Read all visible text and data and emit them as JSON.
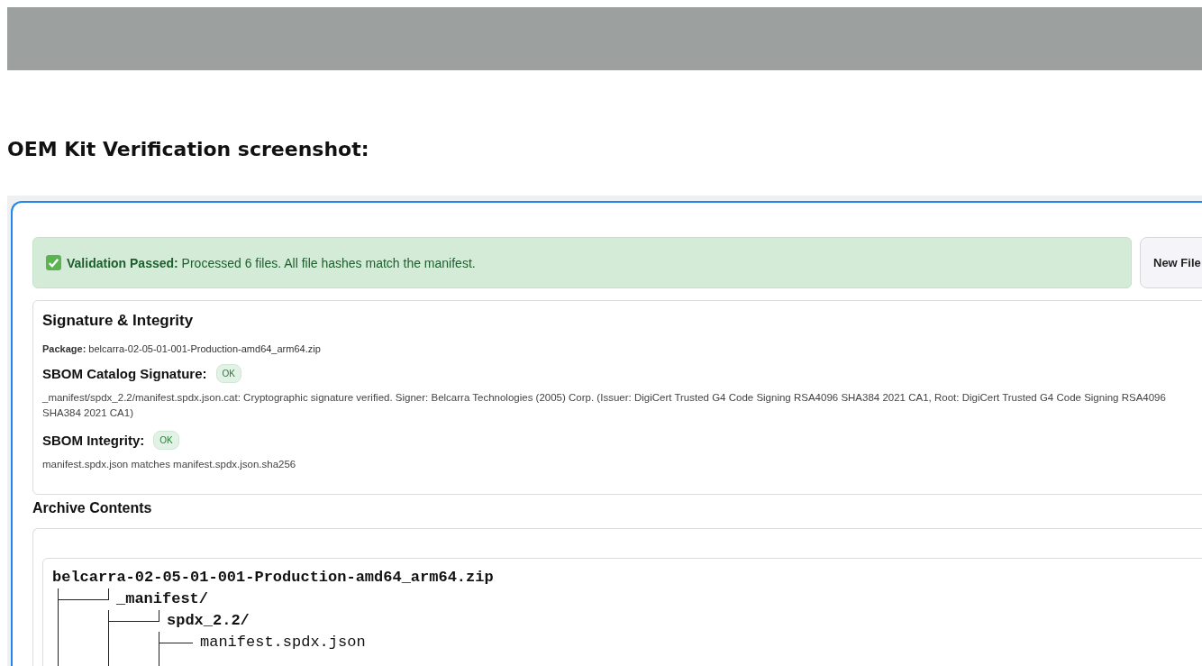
{
  "heading": "OEM Kit Verification screenshot:",
  "alert": {
    "passed": true,
    "title": "Validation Passed:",
    "message": "Processed 6 files. All file hashes match the manifest."
  },
  "new_file_button": "New File",
  "signature": {
    "title": "Signature & Integrity",
    "package_label": "Package:",
    "package": "belcarra-02-05-01-001-Production-amd64_arm64.zip",
    "checks": [
      {
        "title": "SBOM Catalog Signature:",
        "badge": "OK",
        "ok": true,
        "detail": "_manifest/spdx_2.2/manifest.spdx.json.cat: Cryptographic signature verified. Signer: Belcarra Technologies (2005) Corp. (Issuer: DigiCert Trusted G4 Code Signing RSA4096 SHA384 2021 CA1, Root: DigiCert Trusted G4 Code Signing RSA4096 SHA384 2021 CA1)"
      },
      {
        "title": "SBOM Integrity:",
        "badge": "OK",
        "ok": true,
        "detail": "manifest.spdx.json matches manifest.spdx.json.sha256"
      }
    ]
  },
  "archive": {
    "title": "Archive Contents",
    "tree": {
      "name": "belcarra-02-05-01-001-Production-amd64_arm64.zip",
      "kind": "dir",
      "children": [
        {
          "name": "_manifest/",
          "kind": "dir",
          "children": [
            {
              "name": "spdx_2.2/",
              "kind": "dir",
              "children": [
                {
                  "name": "manifest.spdx.json",
                  "kind": "file"
                }
              ]
            }
          ]
        }
      ]
    }
  }
}
